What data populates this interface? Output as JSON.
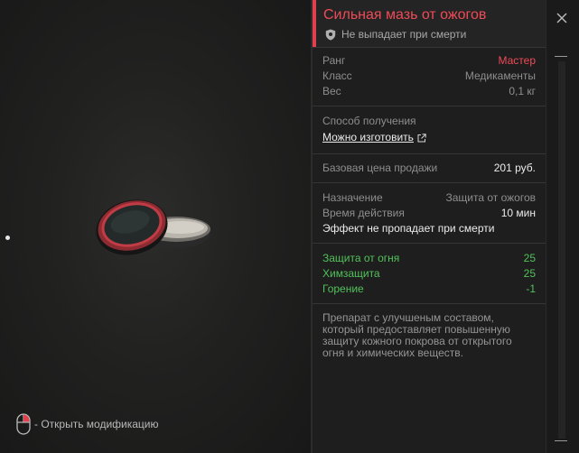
{
  "viewer": {
    "hint_text": "- Открыть модификацию"
  },
  "item": {
    "title": "Сильная мазь от ожогов",
    "subtitle": "Не выпадает при смерти",
    "stats": [
      {
        "label": "Ранг",
        "value": "Мастер"
      },
      {
        "label": "Класс",
        "value": "Медикаменты"
      },
      {
        "label": "Вес",
        "value": "0,1 кг"
      }
    ],
    "obtain": {
      "label": "Способ получения",
      "link": "Можно изготовить"
    },
    "price": {
      "label": "Базовая цена продажи",
      "value": "201 руб."
    },
    "purpose": {
      "label": "Назначение",
      "value": "Защита от ожогов"
    },
    "duration": {
      "label": "Время действия",
      "value": "10 мин"
    },
    "effect_note": "Эффект не пропадает при смерти",
    "bonuses": [
      {
        "label": "Защита от огня",
        "value": "25"
      },
      {
        "label": "Химзащита",
        "value": "25"
      },
      {
        "label": "Горение",
        "value": "-1"
      }
    ],
    "description": "Препарат с улучшеным составом, который предоставляет повышенную защиту кожного покрова от открытого огня и химических веществ."
  },
  "icons": {
    "close": "close-icon",
    "shield": "shield-icon",
    "external_link": "external-link-icon",
    "mouse": "mouse-icon"
  },
  "colors": {
    "accent": "#ee4b57",
    "positive": "#52c15a",
    "panel_bg": "#1e1e1e"
  }
}
